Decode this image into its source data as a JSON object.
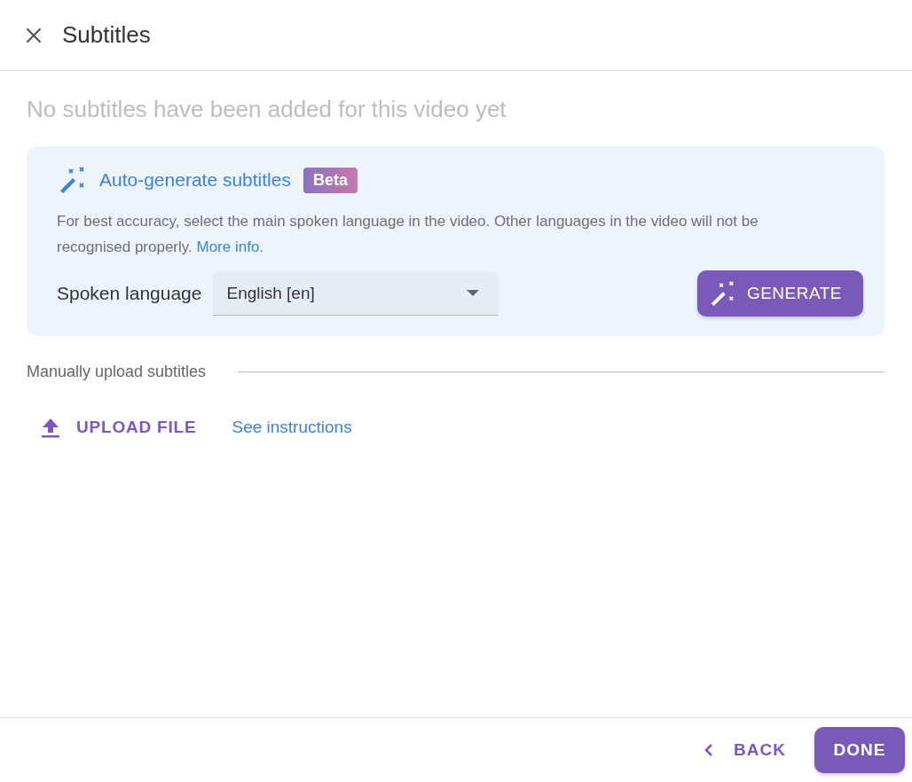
{
  "header": {
    "title": "Subtitles"
  },
  "empty_message": "No subtitles have been added for this video yet",
  "auto_generate": {
    "title": "Auto-generate subtitles",
    "badge": "Beta",
    "description": "For best accuracy, select the main spoken language in the video. Other languages in the video will not be recognised properly.",
    "link": "More info.",
    "language_label": "Spoken language",
    "language_value": "English [en]",
    "button": "GENERATE"
  },
  "manual": {
    "heading": "Manually upload subtitles",
    "upload_button": "UPLOAD FILE",
    "instructions_link": "See instructions"
  },
  "footer": {
    "back": "BACK",
    "done": "DONE"
  }
}
